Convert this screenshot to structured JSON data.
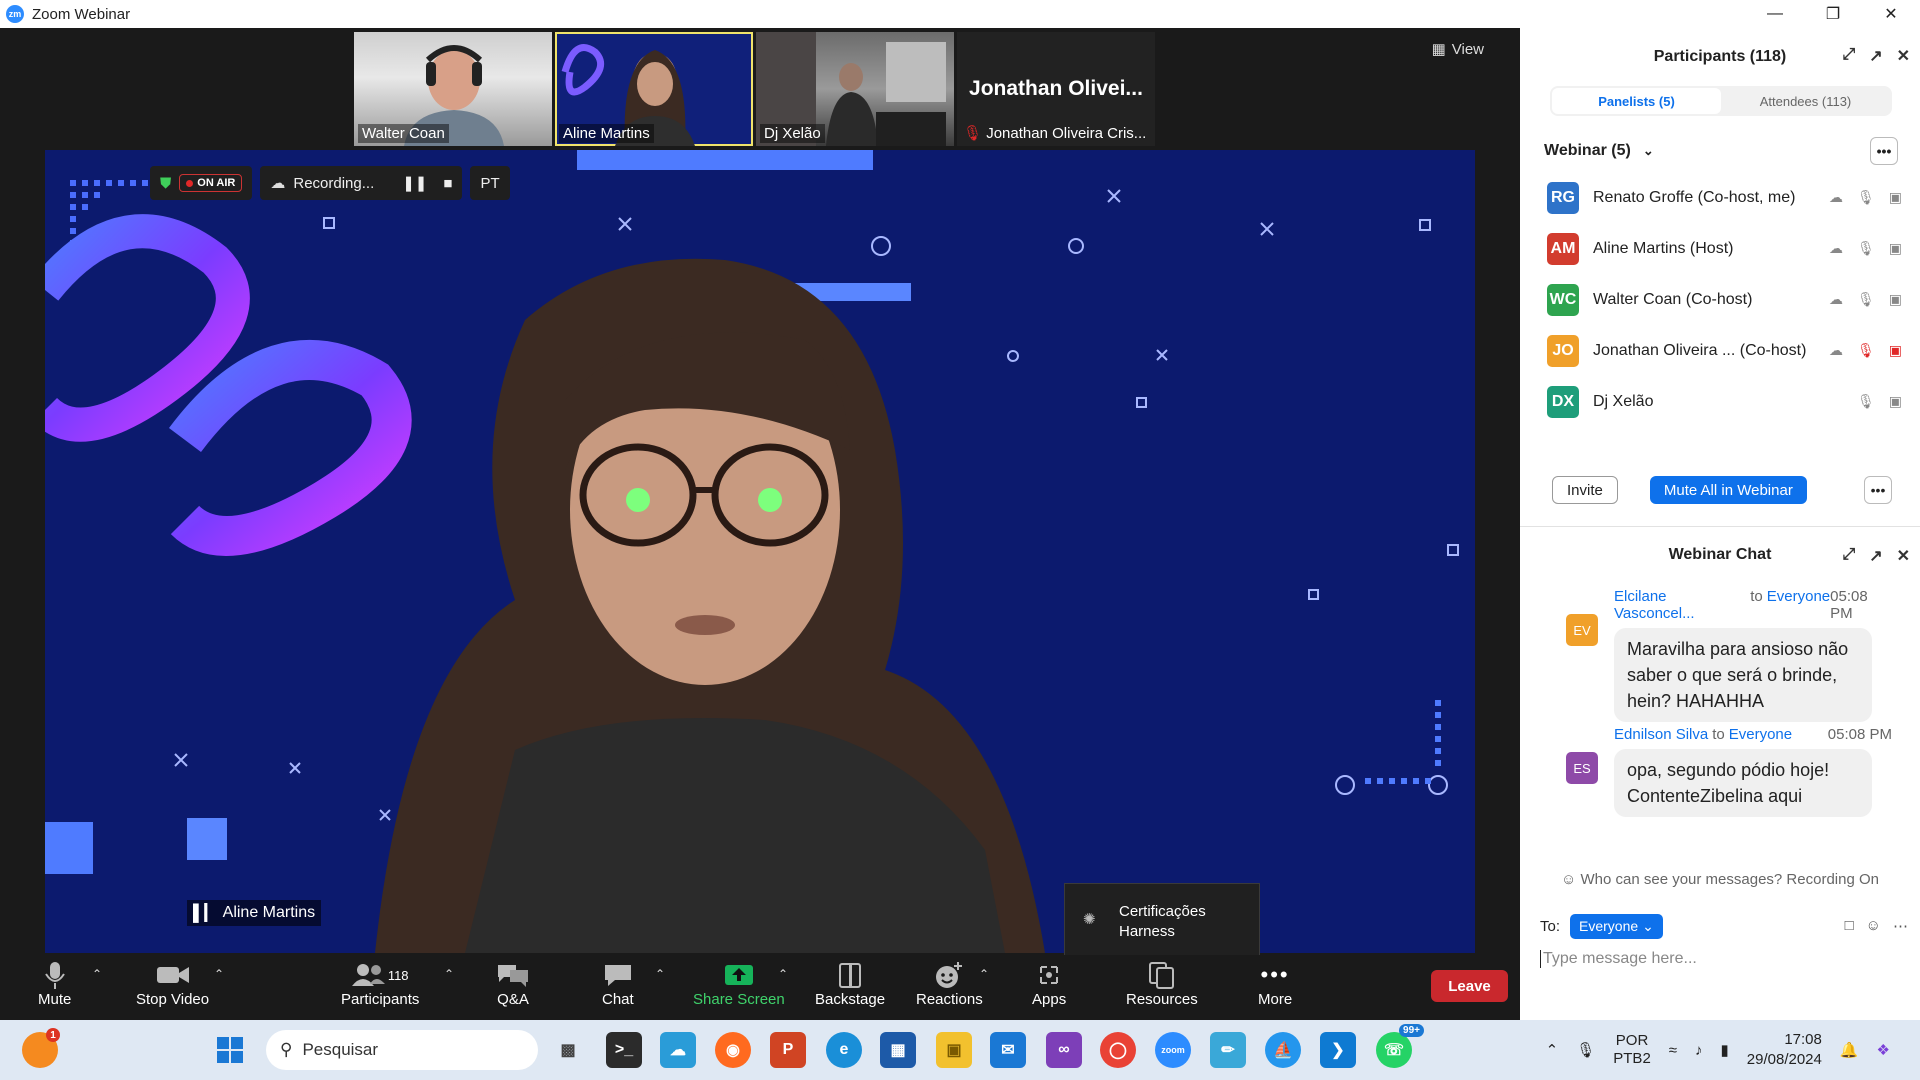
{
  "window": {
    "title": "Zoom Webinar",
    "app_icon": "zm"
  },
  "thumbnails": [
    {
      "name": "Walter Coan"
    },
    {
      "name": "Aline Martins"
    },
    {
      "name": "Dj Xelão"
    }
  ],
  "name_tile": {
    "big_name": "Jonathan  Olivei...",
    "label": "Jonathan Oliveira Cris..."
  },
  "view_button": "View",
  "speaker": {
    "name": "Aline Martins"
  },
  "recording": {
    "on_air": "ON AIR",
    "status": "Recording...",
    "lang": "PT"
  },
  "tooltip": {
    "line1": "Certificações",
    "line2": "Harness"
  },
  "toolbar": {
    "mute": "Mute",
    "stop_video": "Stop Video",
    "participants": "Participants",
    "participants_count": "118",
    "qa": "Q&A",
    "chat": "Chat",
    "share_screen": "Share Screen",
    "backstage": "Backstage",
    "reactions": "Reactions",
    "apps": "Apps",
    "resources": "Resources",
    "more": "More",
    "leave": "Leave"
  },
  "participants_panel": {
    "title": "Participants (118)",
    "tab_panelists": "Panelists (5)",
    "tab_attendees": "Attendees (113)",
    "group": "Webinar (5)",
    "people": [
      {
        "initials": "RG",
        "name": "Renato Groffe (Co-host, me)",
        "color": "#2e73c9"
      },
      {
        "initials": "AM",
        "name": "Aline Martins (Host)",
        "color": "#d23c2e"
      },
      {
        "initials": "WC",
        "name": "Walter Coan (Co-host)",
        "color": "#2ea44f"
      },
      {
        "initials": "JO",
        "name": "Jonathan Oliveira ... (Co-host)",
        "color": "#f0a02a"
      },
      {
        "initials": "DX",
        "name": "Dj Xelão",
        "color": "#1e9e7a"
      }
    ],
    "invite": "Invite",
    "mute_all": "Mute All in Webinar"
  },
  "chat": {
    "title": "Webinar Chat",
    "messages": [
      {
        "initials": "EV",
        "color": "#f0a02a",
        "from": "Elcilane Vasconcel...",
        "to_word": "to",
        "to": "Everyone",
        "time": "05:08 PM",
        "text": "Maravilha para ansioso não saber o que será o brinde, hein? HAHAHHA"
      },
      {
        "initials": "ES",
        "color": "#8e4aa8",
        "from": "Ednilson Silva",
        "to_word": "to",
        "to": "Everyone",
        "time": "05:08 PM",
        "text": "opa, segundo pódio hoje! ContenteZibelina aqui"
      }
    ],
    "privacy": "Who can see your messages? Recording On",
    "to_label": "To:",
    "to_value": "Everyone",
    "placeholder": "Type message here..."
  },
  "taskbar": {
    "search": "Pesquisar",
    "lang1": "POR",
    "lang2": "PTB2",
    "time": "17:08",
    "date": "29/08/2024",
    "badge_first": "1",
    "badge_whatsapp": "99+"
  }
}
